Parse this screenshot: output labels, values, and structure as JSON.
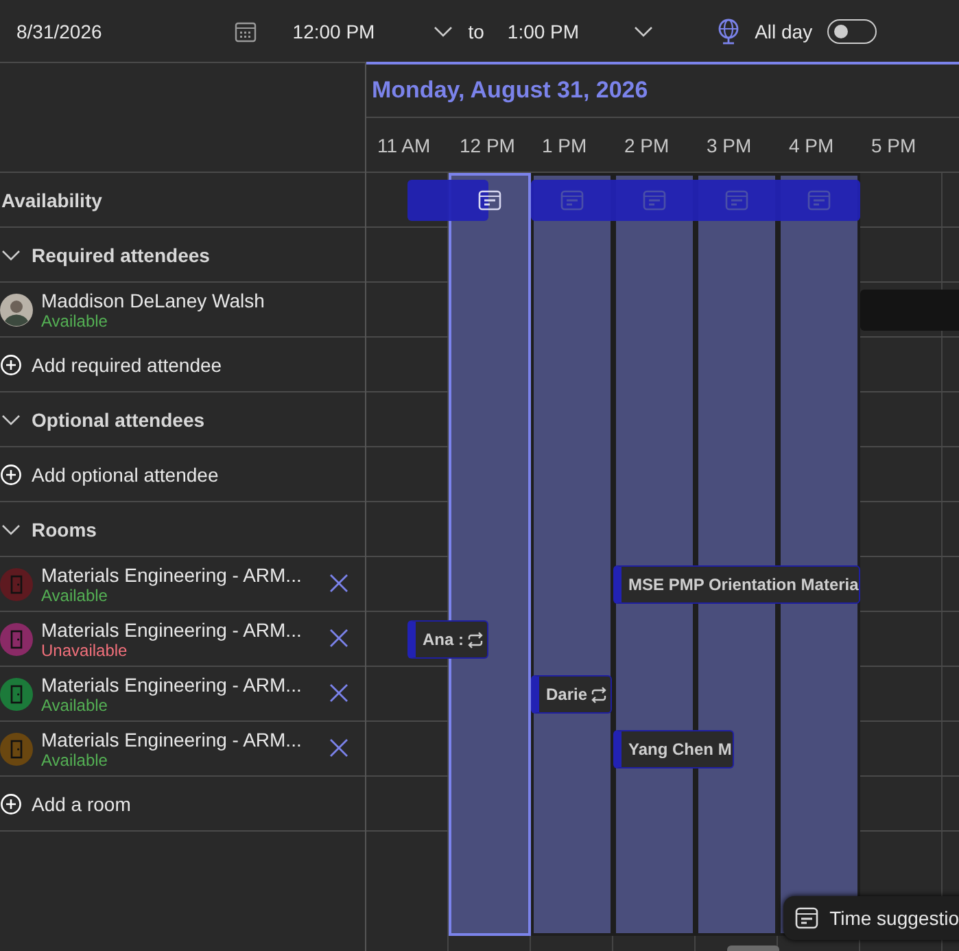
{
  "toolbar": {
    "date": "8/31/2026",
    "start_time": "12:00 PM",
    "to": "to",
    "end_time": "1:00 PM",
    "all_day": {
      "label": "All day",
      "on": false
    }
  },
  "day_header": "Monday, August 31, 2026",
  "hours": [
    "11 AM",
    "12 PM",
    "1 PM",
    "2 PM",
    "3 PM",
    "4 PM",
    "5 PM"
  ],
  "slots": [
    {
      "selected": true
    },
    {
      "selected": false
    },
    {
      "selected": false
    },
    {
      "selected": false
    },
    {
      "selected": false
    }
  ],
  "rows": [
    {
      "kind": "heading",
      "label": "Availability"
    },
    {
      "kind": "group",
      "label": "Required attendees",
      "expanded": true
    },
    {
      "kind": "person",
      "name": "Maddison DeLaney Walsh",
      "status": "Available",
      "available": true
    },
    {
      "kind": "add",
      "label": "Add required attendee"
    },
    {
      "kind": "group",
      "label": "Optional attendees",
      "expanded": true
    },
    {
      "kind": "add",
      "label": "Add optional attendee"
    },
    {
      "kind": "group",
      "label": "Rooms",
      "expanded": true
    },
    {
      "kind": "room",
      "name": "Materials Engineering - ARM...",
      "status": "Available",
      "available": true,
      "color": "#5e1a20",
      "events": [
        {
          "label": "MSE PMP Orientation Materia",
          "recurring": false
        }
      ]
    },
    {
      "kind": "room",
      "name": "Materials Engineering - ARM...",
      "status": "Unavailable",
      "available": false,
      "color": "#8a2a66",
      "events": [
        {
          "label": "Ana :",
          "recurring": true
        }
      ]
    },
    {
      "kind": "room",
      "name": "Materials Engineering - ARM...",
      "status": "Available",
      "available": true,
      "color": "#1c7a3a",
      "events": [
        {
          "label": "Darie",
          "recurring": true
        }
      ]
    },
    {
      "kind": "room",
      "name": "Materials Engineering - ARM...",
      "status": "Available",
      "available": true,
      "color": "#6a4710",
      "events": [
        {
          "label": "Yang Chen M",
          "recurring": false
        }
      ]
    },
    {
      "kind": "add",
      "label": "Add a room"
    }
  ],
  "time_suggestions": "Time suggestio"
}
